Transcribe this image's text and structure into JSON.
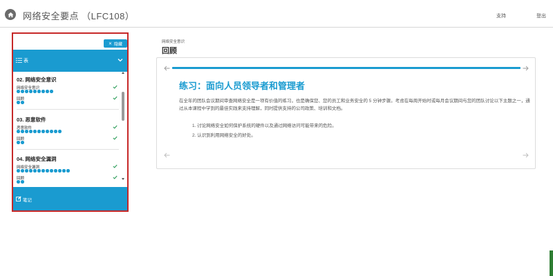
{
  "header": {
    "title": "网络安全要点 （LFC108）",
    "support": "支持",
    "logout": "登出"
  },
  "sidebar": {
    "hide_label": "隐藏",
    "toc_label": "表",
    "notes_label": "笔记",
    "sections": [
      {
        "title": "02. 网络安全意识",
        "items": [
          {
            "label": "网络安全意识",
            "dots": 9,
            "done": true
          },
          {
            "label": "回顾",
            "dots": 2,
            "done": true
          }
        ]
      },
      {
        "title": "03. 恶意软件",
        "items": [
          {
            "label": "恶意软件",
            "dots": 11,
            "done": true
          },
          {
            "label": "回顾",
            "dots": 2,
            "done": true
          }
        ]
      },
      {
        "title": "04. 网络安全漏洞",
        "items": [
          {
            "label": "网络安全漏洞",
            "dots": 13,
            "done": true
          },
          {
            "label": "回顾",
            "dots": 2,
            "done": true
          }
        ]
      }
    ]
  },
  "main": {
    "breadcrumb": "网络安全意识",
    "page_title": "回顾",
    "card": {
      "heading": "练习：面向人员领导者和管理者",
      "body": "在全年的团队会议期间审查网络安全是一项有价值的练习，也是确保您、您的员工和业务安全的 5 分钟步骤。考虑在每周开始时或每月会议期间与您的团队讨论以下主题之一，通过从本课程中学到的最佳实践来支持理解，同时提供支持的公司政策、培训和文档。",
      "list": [
        "1. 讨论网络安全如何保护系统的硬件以及通过网络访问可能带来的危险。",
        "2. 认识到利用网络安全的好处。"
      ]
    }
  },
  "colors": {
    "accent": "#1a9bd0",
    "highlight_border": "#c62828"
  }
}
